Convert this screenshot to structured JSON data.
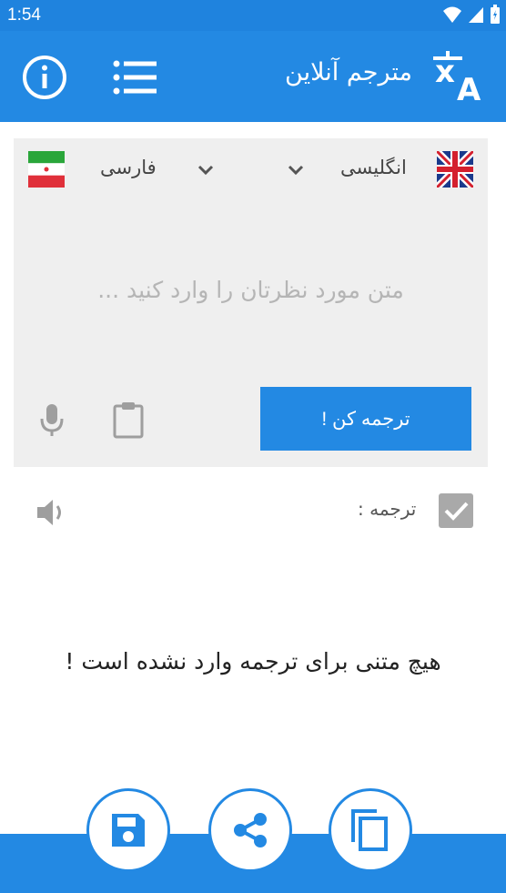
{
  "status": {
    "time": "1:54"
  },
  "appbar": {
    "title": "مترجم آنلاین"
  },
  "languages": {
    "source": "انگلیسی",
    "target": "فارسی"
  },
  "input": {
    "placeholder": "متن مورد نظرتان را وارد کنید ..."
  },
  "actions": {
    "translate_label": "ترجمه کن !"
  },
  "result": {
    "label": "ترجمه :",
    "empty_message": "هیچ متنی برای ترجمه وارد نشده است !"
  },
  "colors": {
    "primary": "#2389e3",
    "statusbar": "#1f83de",
    "card": "#efefef",
    "icon_gray": "#9e9e9e"
  }
}
